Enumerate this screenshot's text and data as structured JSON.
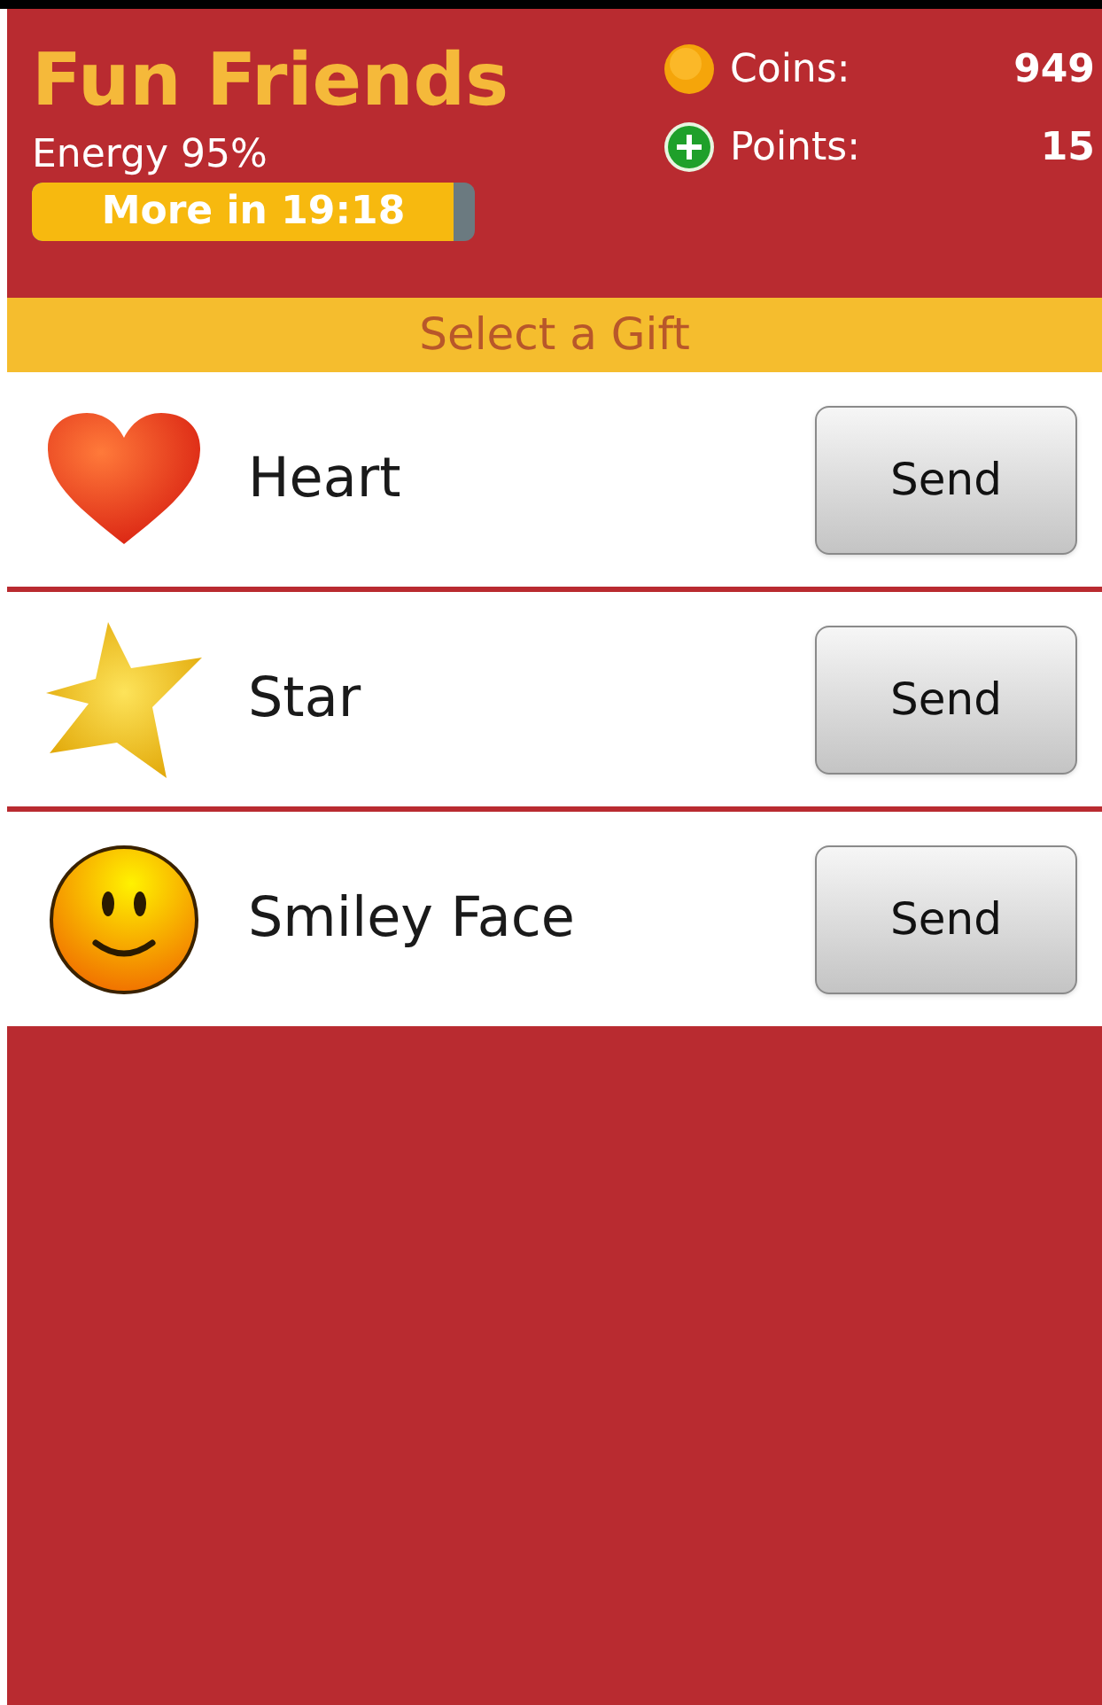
{
  "header": {
    "title": "Fun Friends",
    "energy_label": "Energy 95%",
    "energy_bar": {
      "label": "More in 19:18",
      "level": 0.95
    }
  },
  "stats": [
    {
      "kind": "coin",
      "label": "Coins:",
      "value": "949"
    },
    {
      "kind": "plus",
      "label": "Points:",
      "value": "15"
    }
  ],
  "section_title": "Select a Gift",
  "gifts": [
    {
      "kind": "heart",
      "name": "Heart",
      "button": "Send"
    },
    {
      "kind": "star",
      "name": "Star",
      "button": "Send"
    },
    {
      "kind": "smiley",
      "name": "Smiley Face",
      "button": "Send"
    }
  ]
}
